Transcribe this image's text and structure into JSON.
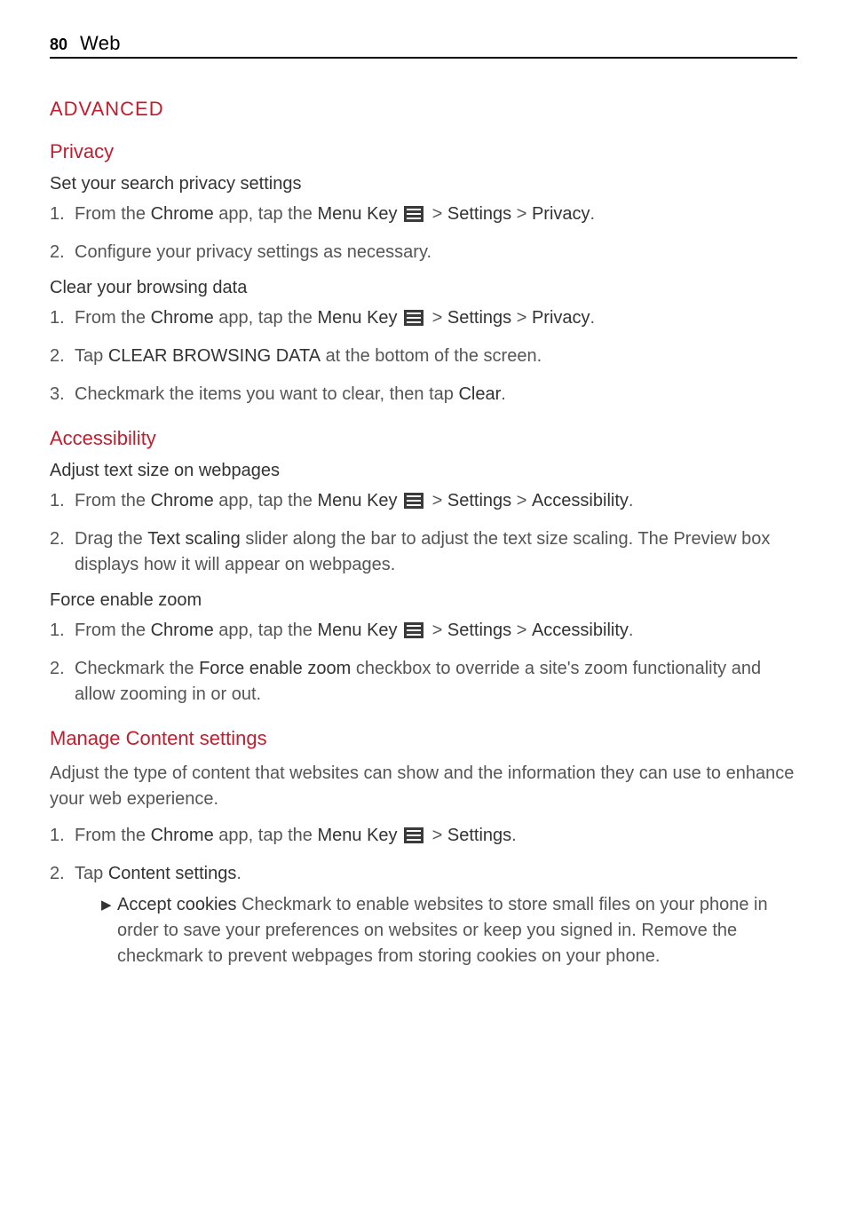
{
  "page": {
    "number": "80",
    "header": "Web"
  },
  "h_advanced": "ADVANCED",
  "h_privacy": "Privacy",
  "privacy_sub1": "Set your search privacy settings",
  "privacy_s1_1_pre": "From the ",
  "privacy_s1_1_chrome": "Chrome",
  "privacy_s1_1_mid": " app, tap the ",
  "privacy_s1_1_mk": "Menu Key",
  "privacy_s1_1_path1": " > ",
  "privacy_s1_1_settings": "Settings",
  "privacy_s1_1_path2": " > ",
  "privacy_s1_1_privacy": "Privacy",
  "privacy_s1_1_dot": ".",
  "privacy_s1_2": "Configure your privacy settings as necessary.",
  "privacy_sub2": "Clear your browsing data",
  "clear_s2_pre": "Tap ",
  "clear_s2_bold": "CLEAR BROWSING DATA",
  "clear_s2_post": " at the bottom of the screen.",
  "clear_s3_pre": "Checkmark the items you want to clear, then tap ",
  "clear_s3_bold": "Clear",
  "clear_s3_post": ".",
  "h_access": "Accessibility",
  "access_sub1": "Adjust text size on webpages",
  "access_s1_1_target": "Accessibility",
  "access_s1_2_pre": "Drag the ",
  "access_s1_2_bold": "Text scaling",
  "access_s1_2_post": " slider along the bar to adjust the text size scaling. The Preview box displays how it will appear on webpages.",
  "access_sub2": "Force enable zoom",
  "zoom_s2_pre": "Checkmark the ",
  "zoom_s2_bold": "Force enable zoom",
  "zoom_s2_post": " checkbox to override a site's zoom functionality and allow zooming in or out.",
  "h_manage": "Manage Content settings",
  "manage_para": "Adjust the type of content that websites can show and the information they can use to enhance your web experience.",
  "manage_s1_settings": "Settings",
  "manage_s1_dot": ".",
  "manage_s2_pre": "Tap ",
  "manage_s2_bold": "Content settings",
  "manage_s2_post": ".",
  "bullet_accept_bold": "Accept cookies",
  "bullet_accept_text": "  Checkmark to enable websites to store small files on your phone in order to save your preferences on websites or keep you signed in. Remove the checkmark to prevent webpages from storing cookies on your phone."
}
